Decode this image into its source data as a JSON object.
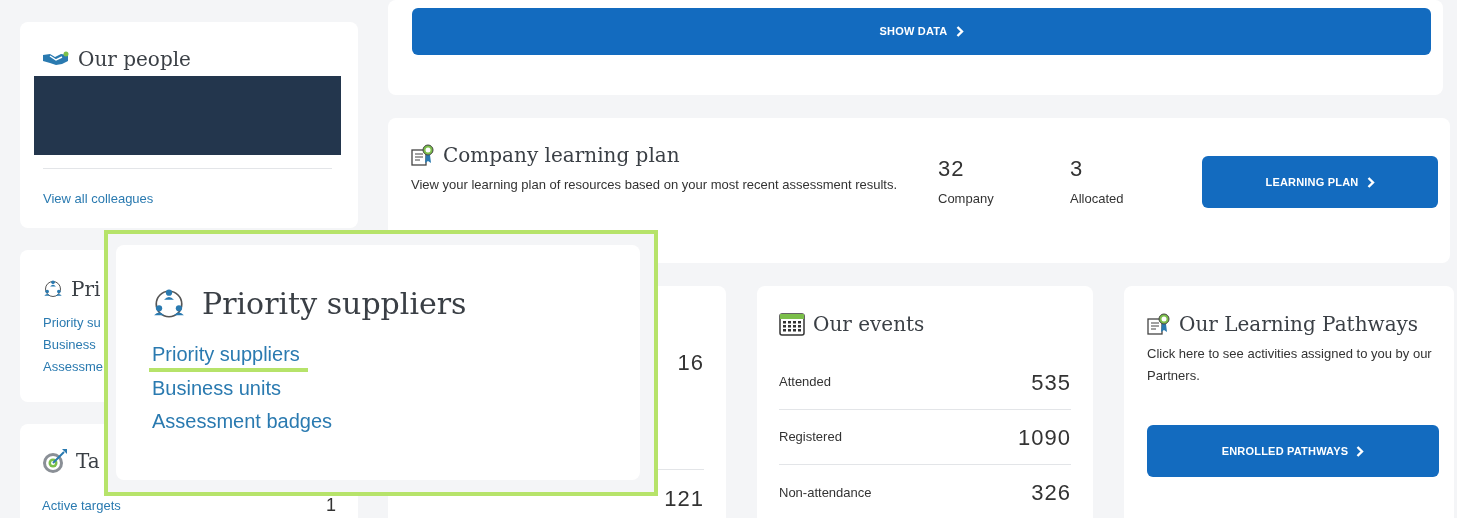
{
  "top_card": {
    "button": "SHOW DATA"
  },
  "our_people": {
    "title": "Our people",
    "link": "View all colleagues"
  },
  "priority_card": {
    "title": "Pri",
    "links": [
      "Priority su",
      "Business",
      "Assessme"
    ]
  },
  "targets_card": {
    "title": "Ta",
    "rows": [
      {
        "label": "Active targets",
        "value": "1"
      }
    ]
  },
  "learning_plan": {
    "title": "Company learning plan",
    "description": "View your learning plan of resources based on your most recent assessment results.",
    "stats": [
      {
        "value": "32",
        "label": "Company"
      },
      {
        "value": "3",
        "label": "Allocated"
      }
    ],
    "button": "LEARNING PLAN"
  },
  "partial_card": {
    "values": [
      "16",
      "121"
    ]
  },
  "events": {
    "title": "Our events",
    "rows": [
      {
        "label": "Attended",
        "value": "535"
      },
      {
        "label": "Registered",
        "value": "1090"
      },
      {
        "label": "Non-attendance",
        "value": "326"
      }
    ]
  },
  "pathways": {
    "title": "Our Learning Pathways",
    "description": "Click here to see activities assigned to you by our Partners.",
    "button": "ENROLLED PATHWAYS"
  },
  "callout": {
    "title": "Priority suppliers",
    "links": [
      {
        "label": "Priority suppliers",
        "selected": true
      },
      {
        "label": "Business units",
        "selected": false
      },
      {
        "label": "Assessment badges",
        "selected": false
      }
    ]
  }
}
